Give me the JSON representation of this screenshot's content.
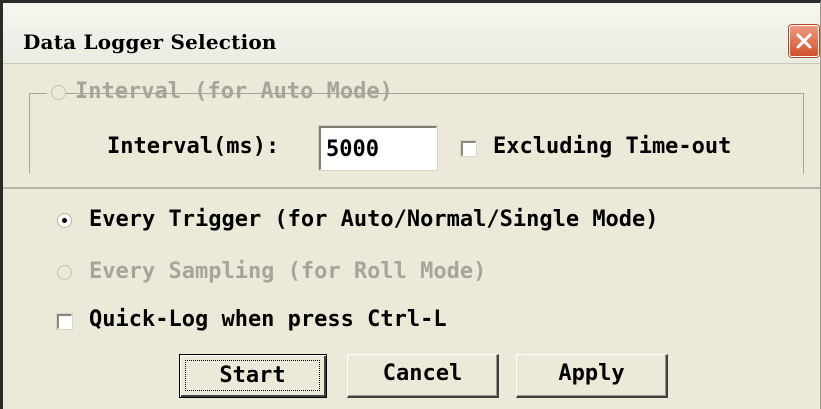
{
  "window": {
    "title": "Data Logger Selection",
    "close_icon": "close-icon"
  },
  "interval_group": {
    "legend": "Interval (for Auto Mode)",
    "legend_enabled": false,
    "selected": false,
    "interval_label": "Interval(ms):",
    "interval_value": "5000",
    "excluding_timeout_label": "Excluding Time-out",
    "excluding_timeout_checked": false
  },
  "options": {
    "every_trigger_label": "Every Trigger (for Auto/Normal/Single Mode)",
    "every_trigger_selected": true,
    "every_sampling_label": "Every Sampling (for Roll Mode)",
    "every_sampling_enabled": false,
    "every_sampling_selected": false,
    "quicklog_label": "Quick-Log when press Ctrl-L",
    "quicklog_checked": false
  },
  "buttons": {
    "start": "Start",
    "cancel": "Cancel",
    "apply": "Apply"
  },
  "colors": {
    "dialog_bg": "#ece9d8",
    "close_button": "#d4502b",
    "disabled_text": "#a6a59c"
  }
}
